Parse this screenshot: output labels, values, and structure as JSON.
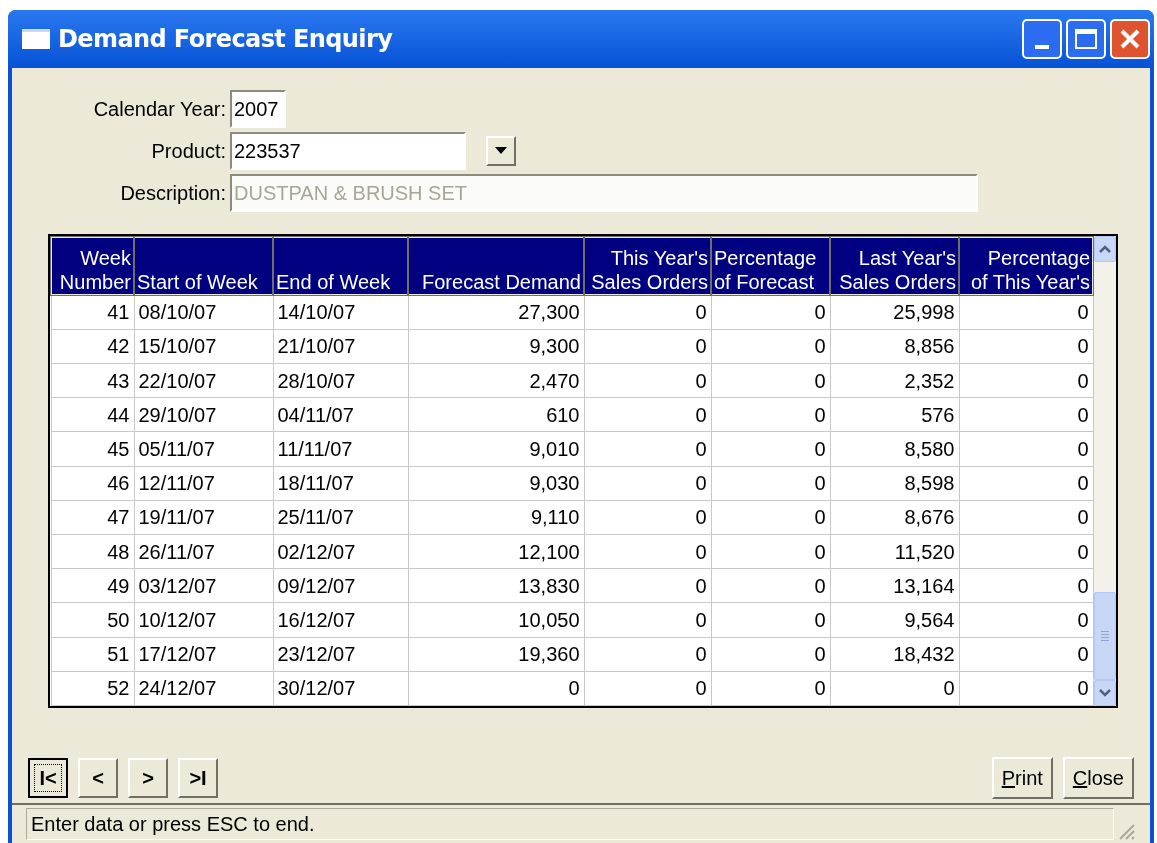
{
  "window": {
    "title": "Demand Forecast Enquiry"
  },
  "form": {
    "calendar_year": {
      "label": "Calendar Year:",
      "value": "2007"
    },
    "product": {
      "label": "Product:",
      "value": "223537"
    },
    "description": {
      "label": "Description:",
      "value": "DUSTPAN & BRUSH SET",
      "disabled": true
    }
  },
  "table": {
    "columns": [
      {
        "line1": "Week",
        "line2": "Number"
      },
      {
        "line2": "Start of Week"
      },
      {
        "line2": "End of Week"
      },
      {
        "line2": "Forecast Demand"
      },
      {
        "line1": "This Year's",
        "line2": "Sales Orders"
      },
      {
        "line1": "Percentage",
        "line2": "of Forecast"
      },
      {
        "line1": "Last Year's",
        "line2": "Sales Orders"
      },
      {
        "line1": "Percentage",
        "line2": "of This Year's"
      }
    ],
    "rows": [
      [
        "41",
        "08/10/07",
        "14/10/07",
        "27,300",
        "0",
        "0",
        "25,998",
        "0"
      ],
      [
        "42",
        "15/10/07",
        "21/10/07",
        "9,300",
        "0",
        "0",
        "8,856",
        "0"
      ],
      [
        "43",
        "22/10/07",
        "28/10/07",
        "2,470",
        "0",
        "0",
        "2,352",
        "0"
      ],
      [
        "44",
        "29/10/07",
        "04/11/07",
        "610",
        "0",
        "0",
        "576",
        "0"
      ],
      [
        "45",
        "05/11/07",
        "11/11/07",
        "9,010",
        "0",
        "0",
        "8,580",
        "0"
      ],
      [
        "46",
        "12/11/07",
        "18/11/07",
        "9,030",
        "0",
        "0",
        "8,598",
        "0"
      ],
      [
        "47",
        "19/11/07",
        "25/11/07",
        "9,110",
        "0",
        "0",
        "8,676",
        "0"
      ],
      [
        "48",
        "26/11/07",
        "02/12/07",
        "12,100",
        "0",
        "0",
        "11,520",
        "0"
      ],
      [
        "49",
        "03/12/07",
        "09/12/07",
        "13,830",
        "0",
        "0",
        "13,164",
        "0"
      ],
      [
        "50",
        "10/12/07",
        "16/12/07",
        "10,050",
        "0",
        "0",
        "9,564",
        "0"
      ],
      [
        "51",
        "17/12/07",
        "23/12/07",
        "19,360",
        "0",
        "0",
        "18,432",
        "0"
      ],
      [
        "52",
        "24/12/07",
        "30/12/07",
        "0",
        "0",
        "0",
        "0",
        "0"
      ]
    ]
  },
  "navigation": [
    {
      "label": "I<",
      "focused": true
    },
    {
      "label": "<",
      "focused": false
    },
    {
      "label": ">",
      "focused": false
    },
    {
      "label": ">I",
      "focused": false
    }
  ],
  "buttons": [
    {
      "label": "Print",
      "mnemonic_first": true
    },
    {
      "label": "Close",
      "mnemonic_first": true
    }
  ],
  "status_bar": "Enter data or press ESC to end."
}
